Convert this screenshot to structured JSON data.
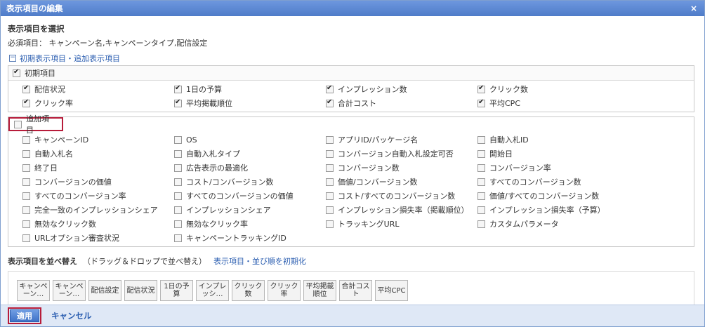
{
  "dialog": {
    "title": "表示項目の編集",
    "close_glyph": "×"
  },
  "select_heading": "表示項目を選択",
  "required_text": "必須項目： キャンペーン名,キャンペーンタイプ,配信設定",
  "toggle_link": "初期表示項目・追加表示項目",
  "initial_group": {
    "label": "初期項目",
    "checked": true,
    "items": [
      {
        "label": "配信状況",
        "checked": true
      },
      {
        "label": "1日の予算",
        "checked": true
      },
      {
        "label": "インプレッション数",
        "checked": true
      },
      {
        "label": "クリック数",
        "checked": true
      },
      {
        "label": "クリック率",
        "checked": true
      },
      {
        "label": "平均掲載順位",
        "checked": true
      },
      {
        "label": "合計コスト",
        "checked": true
      },
      {
        "label": "平均CPC",
        "checked": true
      }
    ]
  },
  "additional_group": {
    "label": "追加項目",
    "checked": false,
    "items": [
      {
        "label": "キャンペーンID",
        "checked": false
      },
      {
        "label": "OS",
        "checked": false
      },
      {
        "label": "アプリID/パッケージ名",
        "checked": false
      },
      {
        "label": "自動入札ID",
        "checked": false
      },
      {
        "label": "自動入札名",
        "checked": false
      },
      {
        "label": "自動入札タイプ",
        "checked": false
      },
      {
        "label": "コンバージョン自動入札設定可否",
        "checked": false
      },
      {
        "label": "開始日",
        "checked": false
      },
      {
        "label": "終了日",
        "checked": false
      },
      {
        "label": "広告表示の最適化",
        "checked": false
      },
      {
        "label": "コンバージョン数",
        "checked": false
      },
      {
        "label": "コンバージョン率",
        "checked": false
      },
      {
        "label": "コンバージョンの価値",
        "checked": false
      },
      {
        "label": "コスト/コンバージョン数",
        "checked": false
      },
      {
        "label": "価値/コンバージョン数",
        "checked": false
      },
      {
        "label": "すべてのコンバージョン数",
        "checked": false
      },
      {
        "label": "すべてのコンバージョン率",
        "checked": false
      },
      {
        "label": "すべてのコンバージョンの価値",
        "checked": false
      },
      {
        "label": "コスト/すべてのコンバージョン数",
        "checked": false
      },
      {
        "label": "価値/すべてのコンバージョン数",
        "checked": false
      },
      {
        "label": "完全一致のインプレッションシェア",
        "checked": false
      },
      {
        "label": "インプレッションシェア",
        "checked": false
      },
      {
        "label": "インプレッション損失率（掲載順位）",
        "checked": false
      },
      {
        "label": "インプレッション損失率（予算）",
        "checked": false
      },
      {
        "label": "無効なクリック数",
        "checked": false
      },
      {
        "label": "無効なクリック率",
        "checked": false
      },
      {
        "label": "トラッキングURL",
        "checked": false
      },
      {
        "label": "カスタムパラメータ",
        "checked": false
      },
      {
        "label": "URLオプション審査状況",
        "checked": false
      },
      {
        "label": "キャンペーントラッキングID",
        "checked": false
      }
    ]
  },
  "sort": {
    "title": "表示項目を並べ替え",
    "note": "（ドラッグ＆ドロップで並べ替え）",
    "reset_link": "表示項目・並び順を初期化",
    "chips": [
      "キャンペ\nーン…",
      "キャンペ\nーン…",
      "配信設定",
      "配信状況",
      "1日の予\n算",
      "インプレ\nッシ…",
      "クリック\n数",
      "クリック\n率",
      "平均掲載\n順位",
      "合計コス\nト",
      "平均CPC"
    ]
  },
  "footer": {
    "apply_label": "適用",
    "cancel_label": "キャンセル"
  },
  "colors": {
    "title_bar": "#5b87d3",
    "highlight": "#b71c3a",
    "link": "#2a5db0",
    "footer_bg": "#dfe8f6"
  }
}
